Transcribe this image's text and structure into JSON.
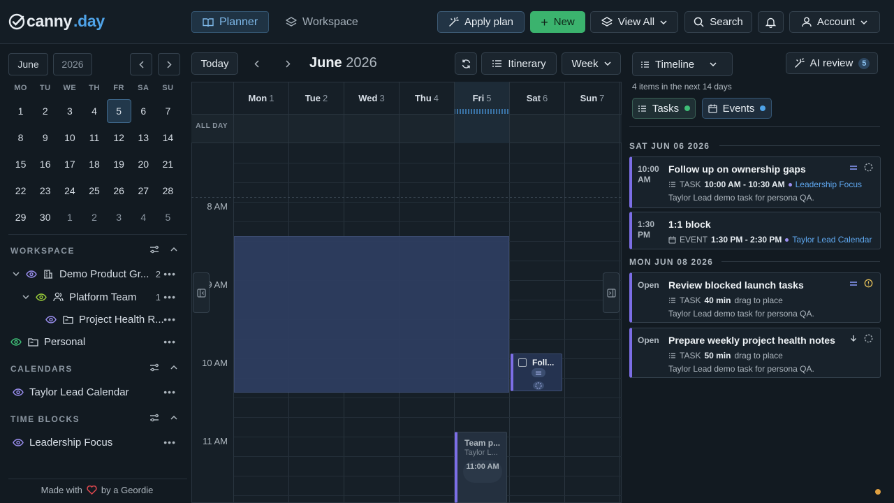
{
  "app": {
    "logo_prefix": "canny",
    "logo_suffix": ".day"
  },
  "topbar": {
    "tabs": [
      {
        "label": "Planner",
        "icon": "book-icon",
        "active": true
      },
      {
        "label": "Workspace",
        "icon": "layers-icon",
        "active": false
      }
    ],
    "apply_plan_label": "Apply plan",
    "new_label": "New",
    "view_all_label": "View All",
    "search_label": "Search",
    "account_label": "Account"
  },
  "sidebar": {
    "month": "June",
    "year": "2026",
    "weekdays": [
      "MO",
      "TU",
      "WE",
      "TH",
      "FR",
      "SA",
      "SU"
    ],
    "weeks": [
      [
        "1",
        "2",
        "3",
        "4",
        "5",
        "6",
        "7"
      ],
      [
        "8",
        "9",
        "10",
        "11",
        "12",
        "13",
        "14"
      ],
      [
        "15",
        "16",
        "17",
        "18",
        "19",
        "20",
        "21"
      ],
      [
        "22",
        "23",
        "24",
        "25",
        "26",
        "27",
        "28"
      ],
      [
        "29",
        "30",
        "1",
        "2",
        "3",
        "4",
        "5"
      ]
    ],
    "selected_day": "5",
    "workspace_title": "WORKSPACE",
    "workspace_items": [
      {
        "label": "Demo Product Gr...",
        "count": "2"
      },
      {
        "label": "Platform Team",
        "count": "1"
      },
      {
        "label": "Project Health R...",
        "count": ""
      },
      {
        "label": "Personal",
        "count": ""
      }
    ],
    "calendars_title": "CALENDARS",
    "calendars": [
      {
        "label": "Taylor Lead Calendar"
      }
    ],
    "time_blocks_title": "TIME BLOCKS",
    "time_blocks": [
      {
        "label": "Leadership Focus"
      }
    ],
    "footer_prefix": "Made with",
    "footer_suffix": "by a Geordie"
  },
  "main": {
    "today_label": "Today",
    "title_month": "June",
    "title_year": "2026",
    "itinerary_label": "Itinerary",
    "week_label": "Week",
    "all_day_label": "ALL DAY",
    "days": [
      {
        "name": "Mon",
        "num": "1"
      },
      {
        "name": "Tue",
        "num": "2"
      },
      {
        "name": "Wed",
        "num": "3"
      },
      {
        "name": "Thu",
        "num": "4"
      },
      {
        "name": "Fri",
        "num": "5"
      },
      {
        "name": "Sat",
        "num": "6"
      },
      {
        "name": "Sun",
        "num": "7"
      }
    ],
    "hours": [
      "8 AM",
      "9 AM",
      "10 AM",
      "11 AM"
    ],
    "event_sat_title": "Foll...",
    "event_fri_title": "Team p...",
    "event_fri_sub": "Taylor L...",
    "event_fri_time": "11:00 AM"
  },
  "right": {
    "timeline_label": "Timeline",
    "ai_review_label": "AI review",
    "ai_review_count": "5",
    "summary": "4 items in the next 14 days",
    "filter_tasks": "Tasks",
    "filter_events": "Events",
    "groups": [
      {
        "date": "SAT JUN 06 2026",
        "items": [
          {
            "time": "10:00 AM",
            "title": "Follow up on ownership gaps",
            "kind": "TASK",
            "range": "10:00 AM - 10:30 AM",
            "link": "Leadership Focus",
            "desc": "Taylor Lead demo task for persona QA."
          },
          {
            "time": "1:30 PM",
            "title": "1:1 block",
            "kind": "EVENT",
            "range": "1:30 PM - 2:30 PM",
            "link": "Taylor Lead Calendar",
            "desc": ""
          }
        ]
      },
      {
        "date": "MON JUN 08 2026",
        "items": [
          {
            "time": "Open",
            "title": "Review blocked launch tasks",
            "kind": "TASK",
            "range": "40 min",
            "link": "drag to place",
            "desc": "Taylor Lead demo task for persona QA."
          },
          {
            "time": "Open",
            "title": "Prepare weekly project health notes",
            "kind": "TASK",
            "range": "50 min",
            "link": "drag to place",
            "desc": "Taylor Lead demo task for persona QA."
          }
        ]
      }
    ]
  },
  "colors": {
    "accent": "#4fa3e8",
    "green": "#3fbf77",
    "purple": "#7c6ee6",
    "card_bg": "#18222b"
  }
}
